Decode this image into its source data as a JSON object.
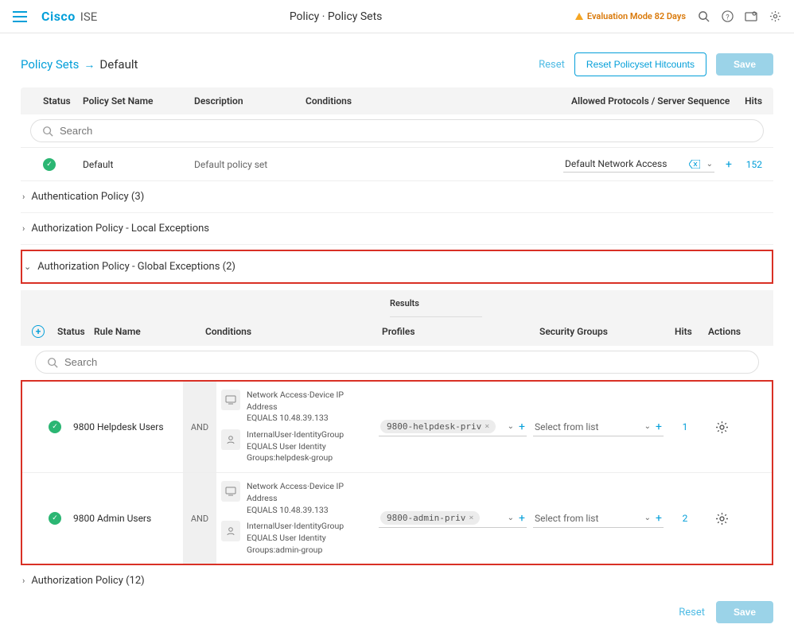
{
  "topbar": {
    "brand_cisco": "Cisco",
    "brand_ise": "ISE",
    "center": "Policy · Policy Sets",
    "eval_text": "Evaluation Mode 82 Days"
  },
  "breadcrumb": {
    "link": "Policy Sets",
    "current": "Default"
  },
  "buttons": {
    "reset": "Reset",
    "reset_hitcounts": "Reset Policyset Hitcounts",
    "save": "Save"
  },
  "headers": {
    "status": "Status",
    "psname": "Policy Set Name",
    "desc": "Description",
    "cond": "Conditions",
    "allowed": "Allowed Protocols / Server Sequence",
    "hits": "Hits"
  },
  "search_placeholder": "Search",
  "ps_row": {
    "name": "Default",
    "desc": "Default policy set",
    "allowed": "Default Network Access",
    "hits": "152"
  },
  "sections": {
    "auth_policy": "Authentication Policy (3)",
    "local_exc": "Authorization Policy - Local Exceptions",
    "global_exc": "Authorization Policy - Global Exceptions (2)",
    "authz_policy": "Authorization Policy (12)"
  },
  "inner_headers": {
    "results": "Results",
    "status": "Status",
    "rulename": "Rule Name",
    "conditions": "Conditions",
    "profiles": "Profiles",
    "secgroups": "Security Groups",
    "hits": "Hits",
    "actions": "Actions"
  },
  "labels": {
    "and": "AND",
    "select_from_list": "Select from list"
  },
  "rules": [
    {
      "name": "9800 Helpdesk Users",
      "cond1": "Network Access·Device IP Address",
      "cond1b": "EQUALS  10.48.39.133",
      "cond2": "InternalUser·IdentityGroup",
      "cond2b": "EQUALS  User Identity Groups:helpdesk-group",
      "profile": "9800-helpdesk-priv",
      "hits": "1"
    },
    {
      "name": "9800 Admin Users",
      "cond1": "Network Access·Device IP Address",
      "cond1b": "EQUALS  10.48.39.133",
      "cond2": "InternalUser·IdentityGroup",
      "cond2b": "EQUALS  User Identity Groups:admin-group",
      "profile": "9800-admin-priv",
      "hits": "2"
    }
  ]
}
